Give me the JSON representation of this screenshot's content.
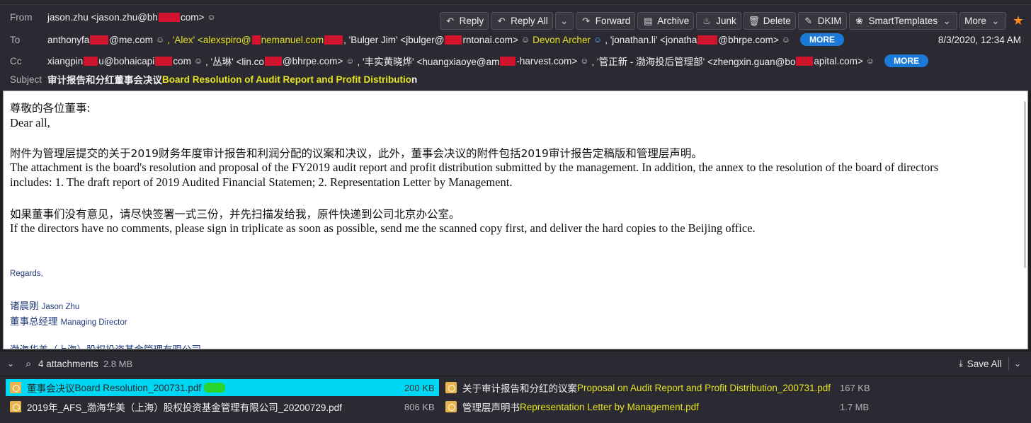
{
  "colors": {
    "accent": "#1b7ad8",
    "highlight": "#e5e321",
    "selected": "#00d7f5",
    "star": "#ff8a1c"
  },
  "toolbar": {
    "reply": "Reply",
    "reply_all": "Reply All",
    "forward": "Forward",
    "archive": "Archive",
    "junk": "Junk",
    "delete": "Delete",
    "dkim": "DKIM",
    "smart_templates": "SmartTemplates",
    "more": "More"
  },
  "header": {
    "from_label": "From",
    "from_value_a": "jason.zhu <jason.zhu@bh",
    "from_value_b": "com>",
    "to_label": "To",
    "to": {
      "r1a": "anthonyfa",
      "r1b": "@me.com",
      "r2a": ", 'Alex' <alexspiro@",
      "r2b": "nemanuel.com",
      "r2c": "'Bulger Jim' <jbulger@",
      "r2d": "rntonai.com>",
      "r3": "Devon Archer",
      "r4a": ", 'jonathan.li' <jonatha",
      "r4b": "@bhrpe.com>"
    },
    "cc_label": "Cc",
    "cc": {
      "c1a": "xiangpin",
      "c1b": "u@bohaicapi",
      "c1c": "com",
      "c2a": ", '丛琳' <lin.co",
      "c2b": "@bhrpe.com>",
      "c3a": ", '丰实黄晓烨' <huangxiaoye@am",
      "c3b": "-harvest.com>",
      "c4a": ", '管正新 - 渤海投后管理部' <zhengxin.guan@bo",
      "c4b": "apital.com>"
    },
    "more_label": "MORE",
    "date": "8/3/2020, 12:34 AM",
    "subject_label": "Subject",
    "subject_zh": "审计报告和分红董事会决议",
    "subject_en": "Board Resolution of Audit Report and Profit Distributio",
    "subject_tail": "n"
  },
  "body": {
    "greet_zh": "尊敬的各位董事:",
    "greet_en": "Dear all,",
    "p1_zh": "附件为管理层提交的关于2019财务年度审计报告和利润分配的议案和决议，此外，董事会决议的附件包括2019审计报告定稿版和管理层声明。",
    "p1_en_1": "The attachment is the board's resolution and proposal of the FY2019 audit report and profit distribution submitted by the management. In addition, the annex to the resolution of the board of directors",
    "p1_en_2": "includes: 1. The draft report of 2019 Audited Financial Statemen; 2. Representation Letter by Management.",
    "p2_zh": "如果董事们没有意见，请尽快签署一式三份，并先扫描发给我，原件快递到公司北京办公室。",
    "p2_en": "If the directors have no comments, please sign in triplicate as soon as possible, send me the scanned copy first, and deliver the hard copies to the Beijing office.",
    "regards": "Regards,",
    "sig_name_zh": "诸晨刚",
    "sig_name_en": "Jason Zhu",
    "sig_title_zh": "董事总经理",
    "sig_title_en": "Managing Director",
    "sig_company": "渤海华美（上海）股权投资基金管理有限公司"
  },
  "attachments": {
    "summary": "4 attachments",
    "total_size": "2.8 MB",
    "save_all": "Save All",
    "items": [
      {
        "name_zh": "董事会决议",
        "name_en": "Board Resolution_200731.pdf",
        "size": "200 KB"
      },
      {
        "name_zh": "关于审计报告和分红的议案 ",
        "name_en": "Proposal on Audit Report and Profit Distribution_200731.pdf",
        "size": "167 KB"
      },
      {
        "name": "2019年_AFS_渤海华美（上海）股权投资基金管理有限公司_20200729.pdf",
        "size": "806 KB"
      },
      {
        "name_zh": "管理层声明书",
        "name_en": "Representation Letter by Management.pdf",
        "size": "1.7 MB"
      }
    ]
  }
}
